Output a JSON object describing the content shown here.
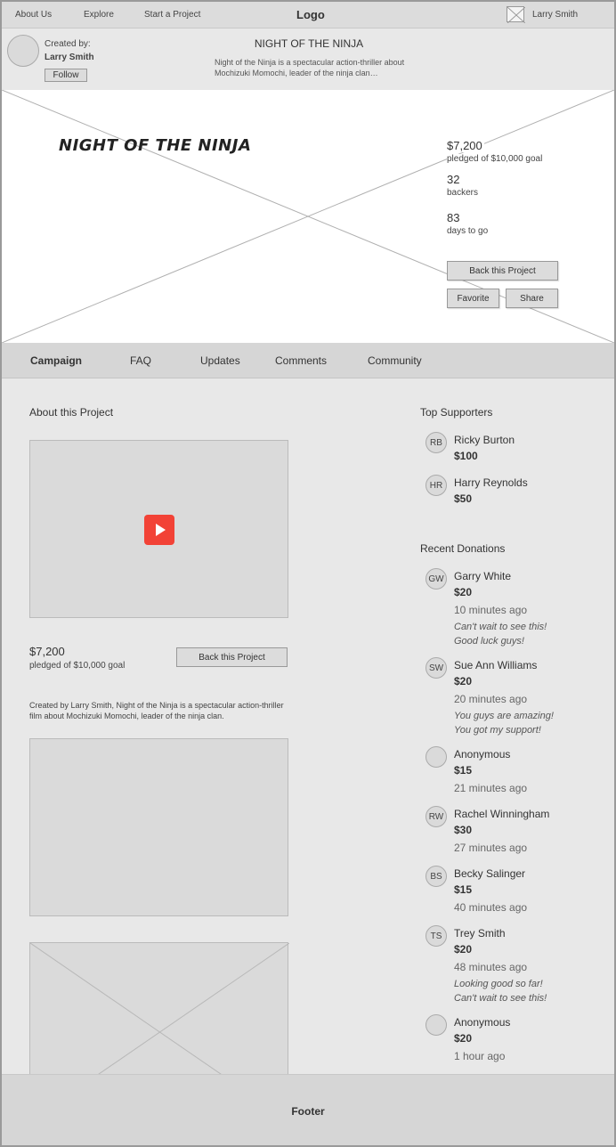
{
  "topnav": {
    "links": [
      "About Us",
      "Explore",
      "Start a Project"
    ],
    "logo": "Logo",
    "user": "Larry Smith"
  },
  "creator": {
    "created_by_label": "Created by:",
    "name": "Larry Smith",
    "follow_label": "Follow",
    "project_title": "NIGHT OF THE NINJA",
    "project_desc": "Night of the Ninja is a spectacular action-thriller about Mochizuki Momochi, leader of the ninja clan…"
  },
  "hero": {
    "title": "NIGHT OF THE NINJA",
    "pledged": "$7,200",
    "pledged_sub": "pledged of $10,000 goal",
    "backers": "32",
    "backers_label": "backers",
    "days": "83",
    "days_label": "days to go",
    "back_label": "Back this Project",
    "favorite_label": "Favorite",
    "share_label": "Share"
  },
  "tabs": [
    "Campaign",
    "FAQ",
    "Updates",
    "Comments",
    "Community"
  ],
  "main": {
    "about_heading": "About this Project",
    "amount": "$7,200",
    "amount_sub": "pledged of $10,000 goal",
    "back_label": "Back this Project",
    "description": "Created by Larry Smith, Night of the Ninja is a spectacular action-thriller film about Mochizuki Momochi, leader of the ninja clan."
  },
  "top_supporters": {
    "heading": "Top Supporters",
    "items": [
      {
        "initials": "RB",
        "name": "Ricky Burton",
        "amount": "$100"
      },
      {
        "initials": "HR",
        "name": "Harry Reynolds",
        "amount": "$50"
      }
    ]
  },
  "recent_donations": {
    "heading": "Recent Donations",
    "items": [
      {
        "initials": "GW",
        "name": "Garry White",
        "amount": "$20",
        "time": "10 minutes ago",
        "msg1": "Can't wait to see this!",
        "msg2": "Good luck guys!"
      },
      {
        "initials": "SW",
        "name": "Sue Ann Williams",
        "amount": "$20",
        "time": "20 minutes ago",
        "msg1": "You guys are amazing!",
        "msg2": "You got my support!"
      },
      {
        "initials": "",
        "name": "Anonymous",
        "amount": "$15",
        "time": "21 minutes ago"
      },
      {
        "initials": "RW",
        "name": "Rachel Winningham",
        "amount": "$30",
        "time": "27 minutes ago"
      },
      {
        "initials": "BS",
        "name": "Becky Salinger",
        "amount": "$15",
        "time": "40 minutes ago"
      },
      {
        "initials": "TS",
        "name": "Trey Smith",
        "amount": "$20",
        "time": "48 minutes ago",
        "msg1": "Looking good so far!",
        "msg2": "Can't wait to see this!"
      },
      {
        "initials": "",
        "name": "Anonymous",
        "amount": "$20",
        "time": "1 hour ago"
      }
    ]
  },
  "footer": {
    "label": "Footer"
  },
  "colors": {
    "play_button": "#f24236",
    "nav_bg": "#dcdcdc",
    "page_bg": "#e8e8e8"
  }
}
